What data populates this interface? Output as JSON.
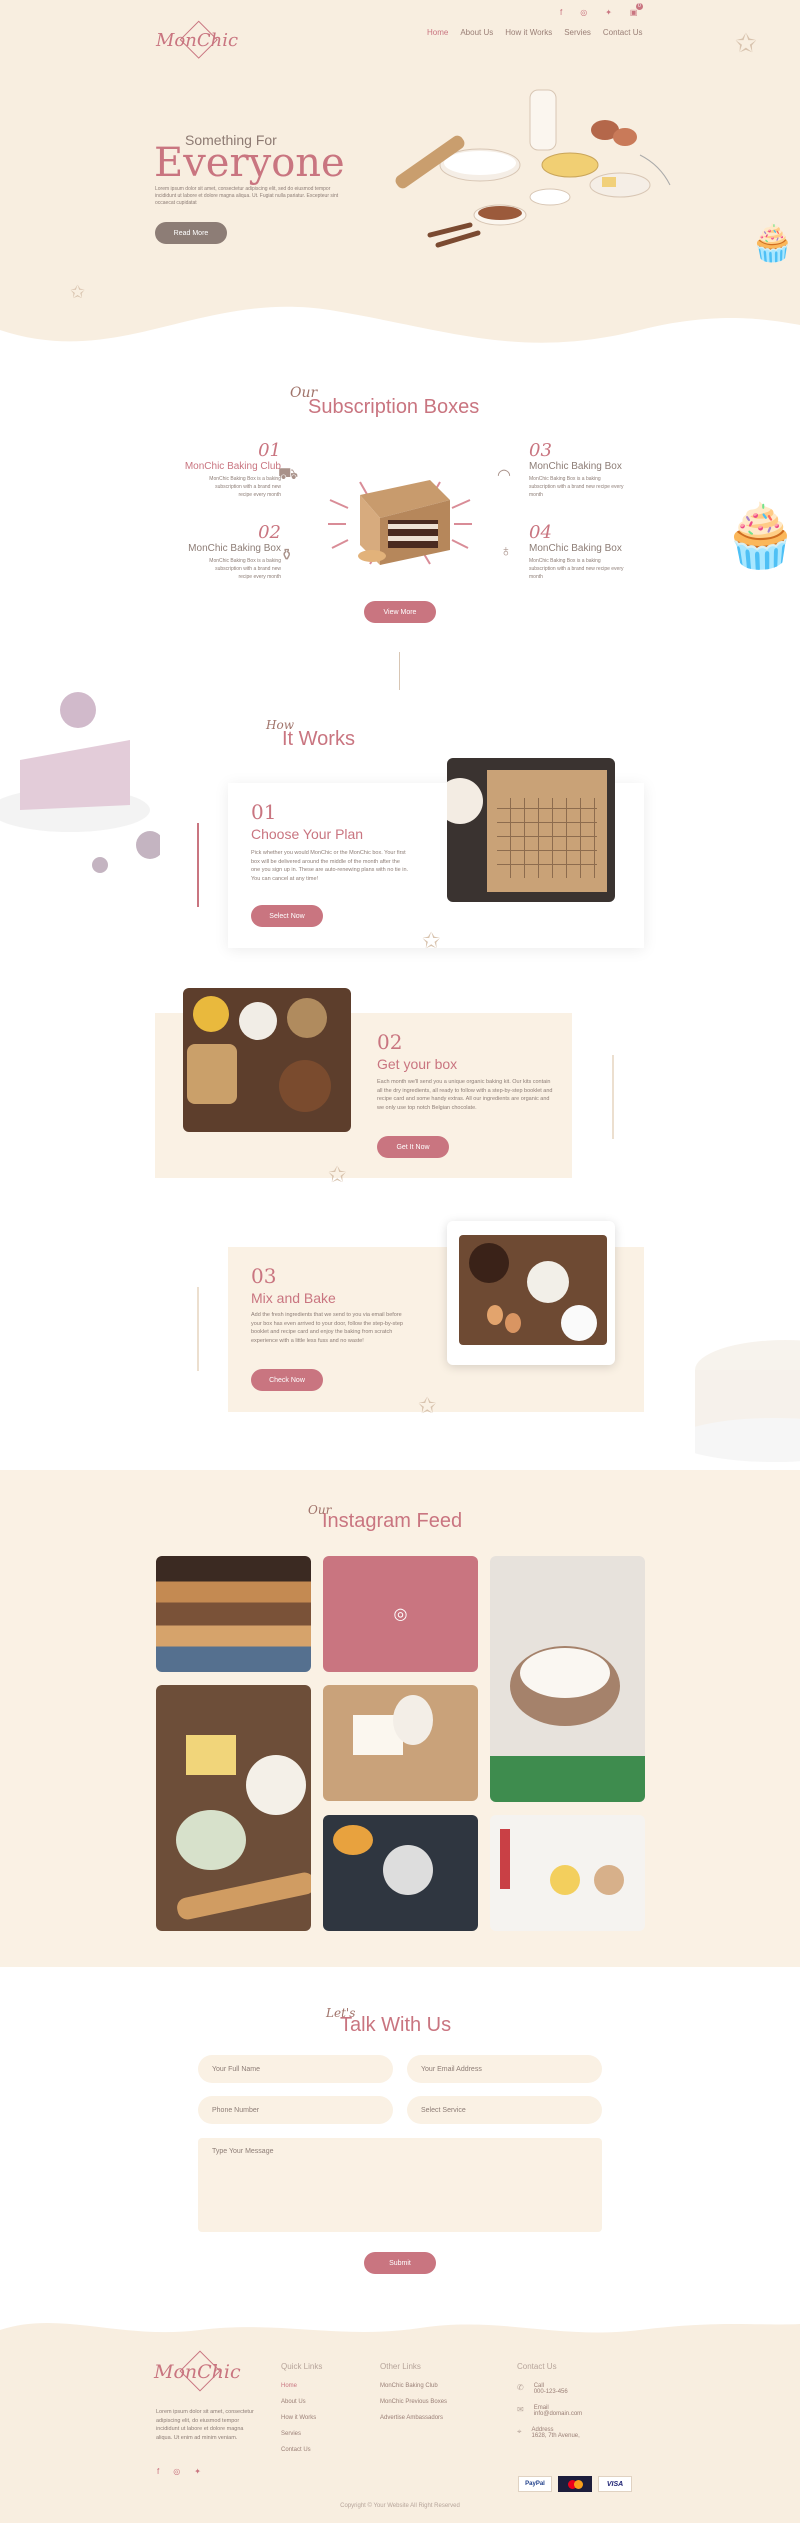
{
  "header": {
    "logo_text": "MonChic",
    "social_icons": [
      "facebook-icon",
      "instagram-icon",
      "twitter-icon",
      "cart-icon"
    ],
    "cart_count": "0",
    "nav": [
      {
        "label": "Home",
        "active": true
      },
      {
        "label": "About Us",
        "active": false
      },
      {
        "label": "How it Works",
        "active": false
      },
      {
        "label": "Servies",
        "active": false
      },
      {
        "label": "Contact Us",
        "active": false
      }
    ]
  },
  "hero": {
    "subtitle": "Something For",
    "title": "Everyone",
    "text": "Lorem ipsum dolor sit amet, consectetur adipiscing elit, sed do eiusmod tempor incididunt ut labore et dolore magna aliqua. Ut. Fugiat nulla pariatur. Excepteur sint occaecat cupidatat",
    "button": "Read More"
  },
  "subscription": {
    "script": "Our",
    "title": "Subscription Boxes",
    "items": [
      {
        "num": "01",
        "title": "MonChic Baking Club",
        "text": "MonChic Baking Box is a baking subscription with a brand new recipe every month",
        "icon": "truck-icon"
      },
      {
        "num": "02",
        "title": "MonChic Baking Box",
        "text": "MonChic Baking Box is a baking subscription with a brand new recipe every month",
        "icon": "mixer-icon"
      },
      {
        "num": "03",
        "title": "MonChic Baking Box",
        "text": "MonChic Baking Box is a baking subscription with a brand new recipe every month",
        "icon": "bread-icon"
      },
      {
        "num": "04",
        "title": "MonChic Baking Box",
        "text": "MonChic Baking Box is a baking subscription with a brand new recipe every month",
        "icon": "cake-icon"
      }
    ],
    "button": "View More"
  },
  "how": {
    "script": "How",
    "title": "It Works",
    "steps": [
      {
        "num": "01",
        "title": "Choose Your Plan",
        "text": "Pick whether you would MonChic or the MonChic box. Your first box will be delivered around the middle of the month after the one you sign up in. These are auto-renewing plans with no tie in. You can cancel at any time!",
        "button": "Select Now"
      },
      {
        "num": "02",
        "title": "Get your box",
        "text": "Each month we'll send you a unique organic baking kit. Our kits contain all the dry ingredients, all ready to follow with a step-by-step booklet and recipe card and some handy extras. All our ingredients are organic and we only use top notch Belgian chocolate.",
        "button": "Get It Now"
      },
      {
        "num": "03",
        "title": "Mix and Bake",
        "text": "Add the fresh ingredients that we send to you via email before your box has even arrived to your door, follow the step-by-step booklet and recipe card and enjoy the baking from scratch experience with a little less fuss and no waste!",
        "button": "Check Now"
      }
    ]
  },
  "instagram": {
    "script": "Our",
    "title": "Instagram Feed"
  },
  "contact": {
    "script": "Let's",
    "title": "Talk With Us",
    "name_placeholder": "Your Full Name",
    "email_placeholder": "Your Email Address",
    "phone_placeholder": "Phone Number",
    "service_placeholder": "Select Service",
    "message_placeholder": "Type Your Message",
    "button": "Submit"
  },
  "footer": {
    "about": "Lorem ipsum dolor sit amet, consectetur adipiscing elit, do eiusmod tempor incididunt ut labore et dolore magna aliqua. Ut enim ad minim veniam.",
    "quick_title": "Quick Links",
    "quick_links": [
      "Home",
      "About Us",
      "How it Works",
      "Servies",
      "Contact Us"
    ],
    "other_title": "Other Links",
    "other_links": [
      "MonChic Baking Club",
      "MonChic Previous Boxes",
      "Advertise Ambassadors"
    ],
    "contact_title": "Contact Us",
    "call_label": "Call",
    "call_value": "000-123-456",
    "email_label": "Email",
    "email_value": "info@domain.com",
    "address_label": "Address",
    "address_value": "1628, 7th Avenue,",
    "payments": [
      "PayPal",
      "mastercard",
      "VISA"
    ],
    "copyright": "Copyright © Your Website All Right Reserved"
  },
  "colors": {
    "accent": "#c97580",
    "cream": "#faf1e4",
    "text": "#7a6a63"
  }
}
